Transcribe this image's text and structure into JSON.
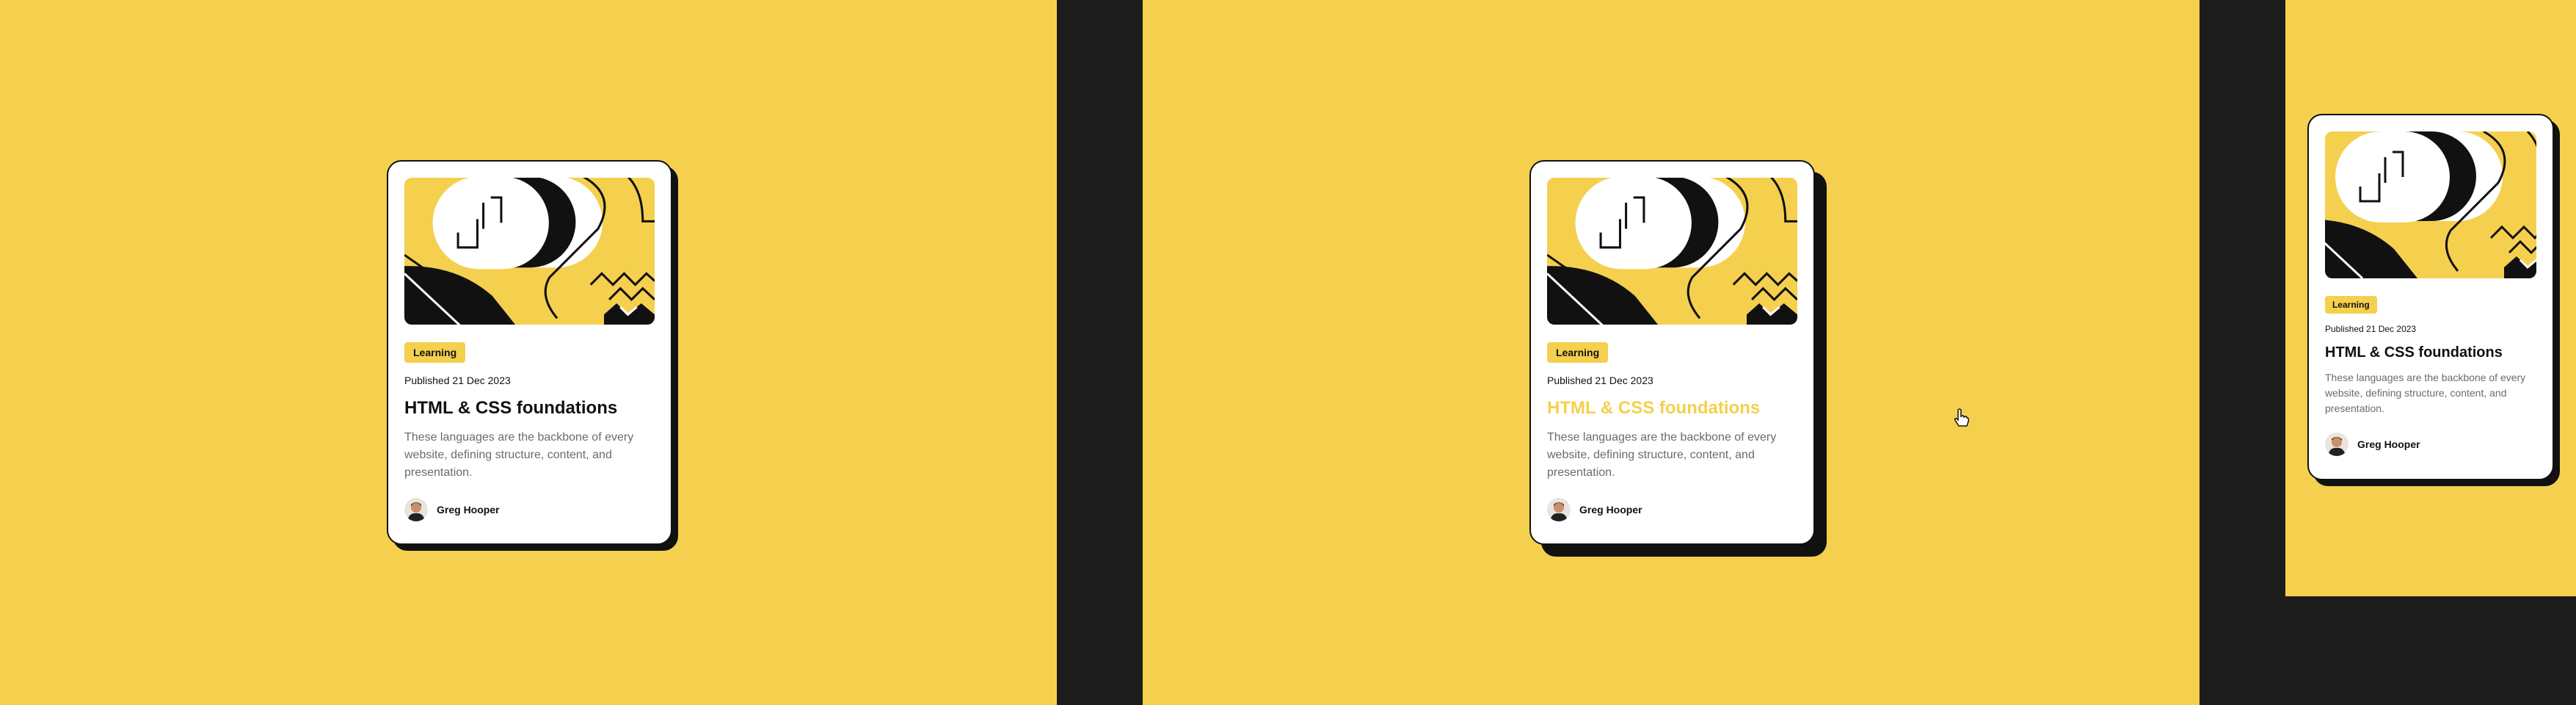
{
  "colors": {
    "accent": "#f4d04e",
    "ink": "#111111",
    "muted": "#6b6b6b",
    "card": "#ffffff"
  },
  "states": [
    {
      "badge": "Learning",
      "published": "Published 21 Dec 2023",
      "title": "HTML & CSS foundations",
      "description": "These languages are the backbone of every website, defining structure, content, and presentation.",
      "author": "Greg Hooper"
    },
    {
      "badge": "Learning",
      "published": "Published 21 Dec 2023",
      "title": "HTML & CSS foundations",
      "description": "These languages are the backbone of every website, defining structure, content, and presentation.",
      "author": "Greg Hooper"
    },
    {
      "badge": "Learning",
      "published": "Published 21 Dec 2023",
      "title": "HTML & CSS foundations",
      "description": "These languages are the backbone of every website, defining structure, content, and presentation.",
      "author": "Greg Hooper"
    }
  ],
  "icons": {
    "cursor": "hand-pointer-icon"
  }
}
